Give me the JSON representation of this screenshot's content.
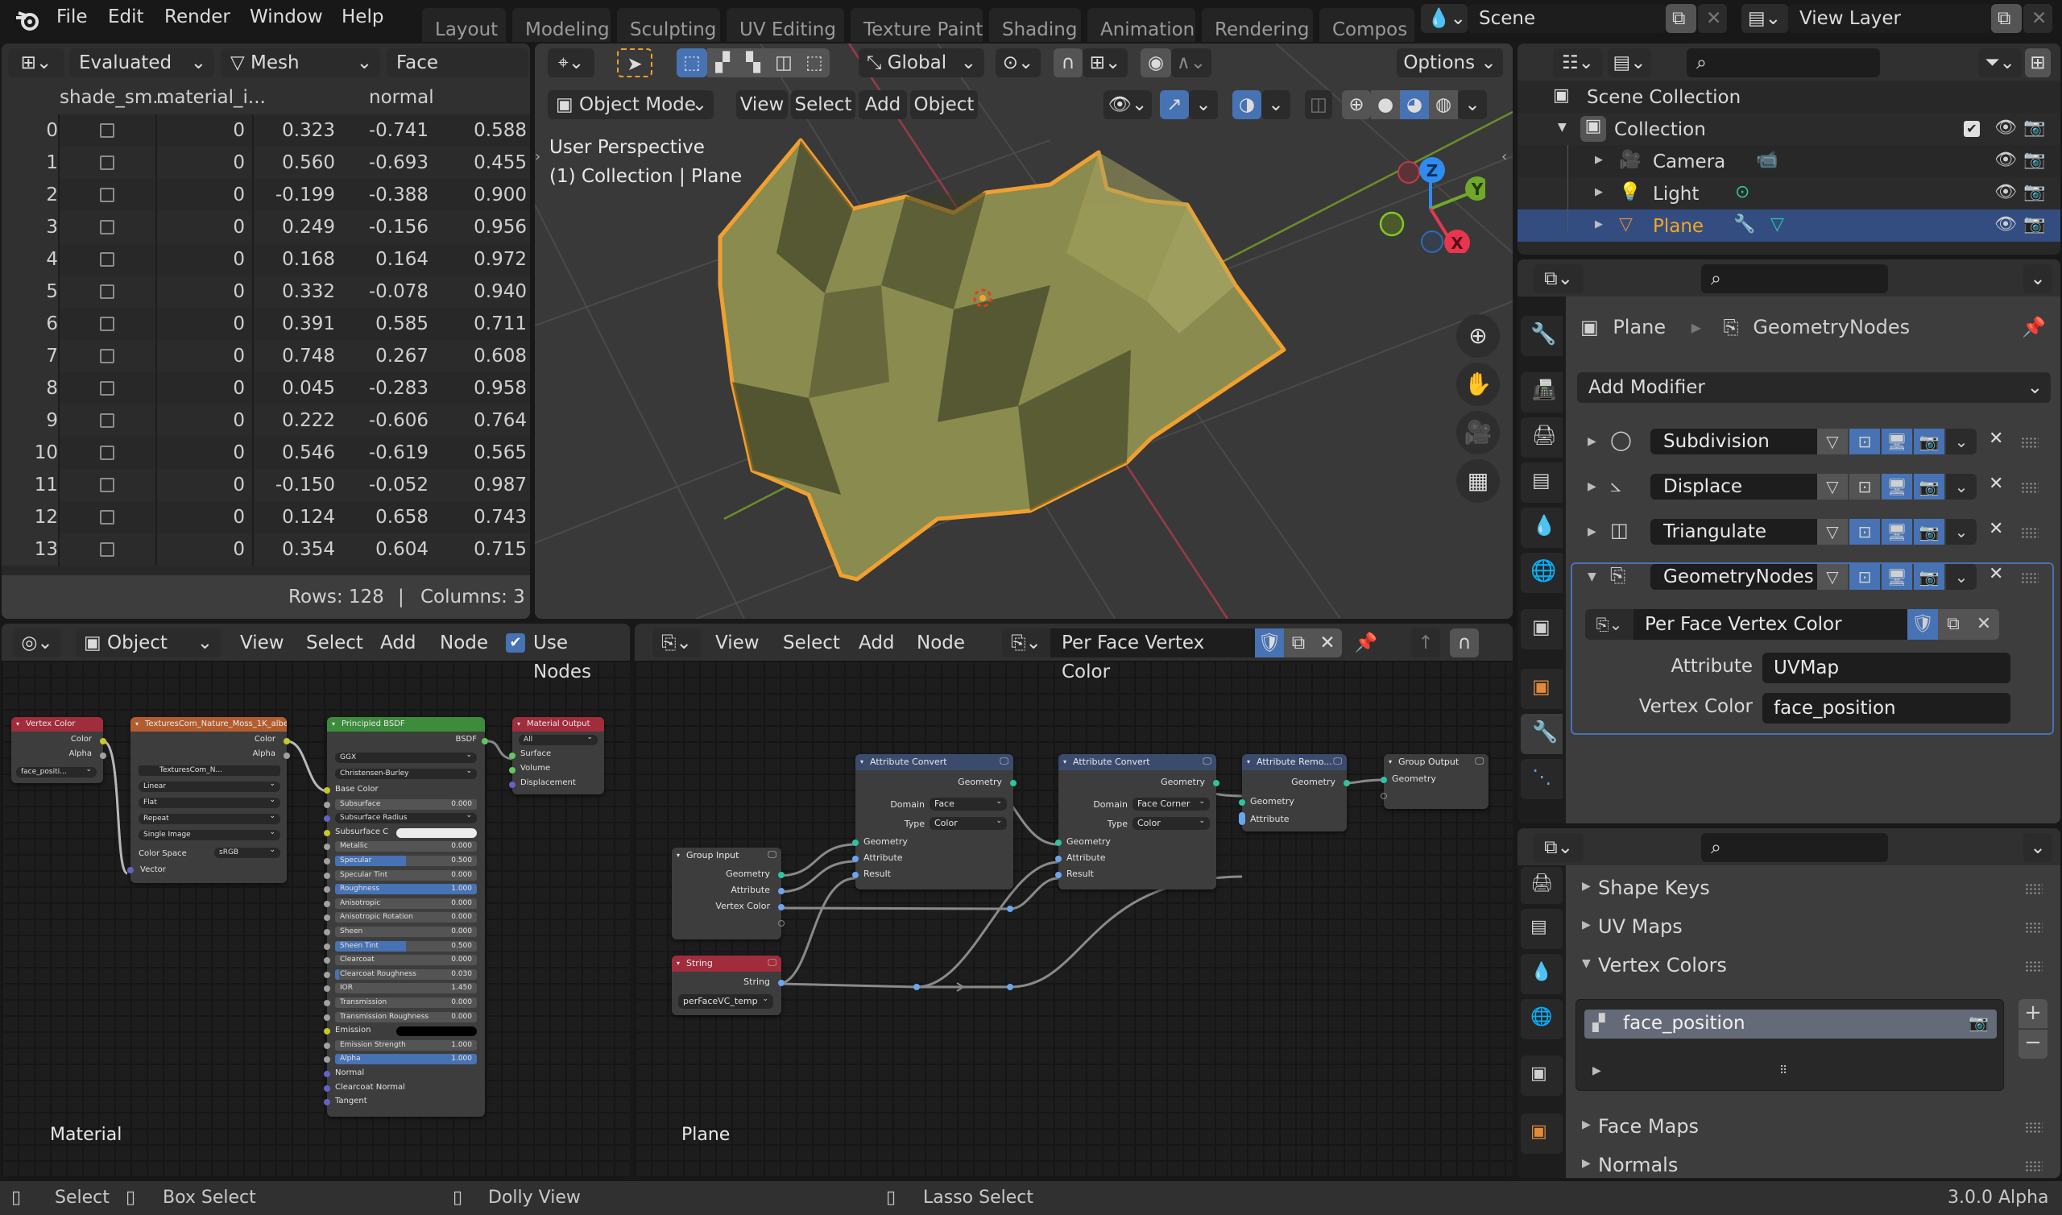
{
  "topbar": {
    "menu": [
      "File",
      "Edit",
      "Render",
      "Window",
      "Help"
    ],
    "workspaces": [
      "Layout",
      "Modeling",
      "Sculpting",
      "UV Editing",
      "Texture Paint",
      "Shading",
      "Animation",
      "Rendering",
      "Compos"
    ],
    "scene": "Scene",
    "view_layer": "View Layer"
  },
  "spreadsheet": {
    "evaluated": "Evaluated",
    "object_type": "Mesh",
    "domain": "Face",
    "columns": [
      "shade_sm...",
      "material_i...",
      "normal"
    ],
    "rows": [
      {
        "i": "0",
        "smooth": false,
        "mat": "0",
        "n": [
          "0.323",
          "-0.741",
          "0.588"
        ]
      },
      {
        "i": "1",
        "smooth": false,
        "mat": "0",
        "n": [
          "0.560",
          "-0.693",
          "0.455"
        ]
      },
      {
        "i": "2",
        "smooth": false,
        "mat": "0",
        "n": [
          "-0.199",
          "-0.388",
          "0.900"
        ]
      },
      {
        "i": "3",
        "smooth": false,
        "mat": "0",
        "n": [
          "0.249",
          "-0.156",
          "0.956"
        ]
      },
      {
        "i": "4",
        "smooth": false,
        "mat": "0",
        "n": [
          "0.168",
          "0.164",
          "0.972"
        ]
      },
      {
        "i": "5",
        "smooth": false,
        "mat": "0",
        "n": [
          "0.332",
          "-0.078",
          "0.940"
        ]
      },
      {
        "i": "6",
        "smooth": false,
        "mat": "0",
        "n": [
          "0.391",
          "0.585",
          "0.711"
        ]
      },
      {
        "i": "7",
        "smooth": false,
        "mat": "0",
        "n": [
          "0.748",
          "0.267",
          "0.608"
        ]
      },
      {
        "i": "8",
        "smooth": false,
        "mat": "0",
        "n": [
          "0.045",
          "-0.283",
          "0.958"
        ]
      },
      {
        "i": "9",
        "smooth": false,
        "mat": "0",
        "n": [
          "0.222",
          "-0.606",
          "0.764"
        ]
      },
      {
        "i": "10",
        "smooth": false,
        "mat": "0",
        "n": [
          "0.546",
          "-0.619",
          "0.565"
        ]
      },
      {
        "i": "11",
        "smooth": false,
        "mat": "0",
        "n": [
          "-0.150",
          "-0.052",
          "0.987"
        ]
      },
      {
        "i": "12",
        "smooth": false,
        "mat": "0",
        "n": [
          "0.124",
          "0.658",
          "0.743"
        ]
      },
      {
        "i": "13",
        "smooth": false,
        "mat": "0",
        "n": [
          "0.354",
          "0.604",
          "0.715"
        ]
      }
    ],
    "footer": {
      "rows": "Rows: 128",
      "sep": "|",
      "columns": "Columns: 3"
    }
  },
  "viewport": {
    "transform_orientation": "Global",
    "options": "Options",
    "mode": "Object Mode",
    "menus": [
      "View",
      "Select",
      "Add",
      "Object"
    ],
    "overlay_line1": "User Perspective",
    "overlay_line2": "(1) Collection | Plane",
    "gizmo_axes": [
      "Z",
      "Y",
      "X"
    ]
  },
  "outliner": {
    "root": "Scene Collection",
    "collection": "Collection",
    "items": [
      {
        "name": "Camera",
        "selected": false
      },
      {
        "name": "Light",
        "selected": false
      },
      {
        "name": "Plane",
        "selected": true
      }
    ]
  },
  "properties": {
    "breadcrumb": [
      "Plane",
      "GeometryNodes"
    ],
    "add_modifier": "Add Modifier",
    "modifiers": [
      {
        "name": "Subdivision",
        "editmode": true
      },
      {
        "name": "Displace",
        "editmode": false
      },
      {
        "name": "Triangulate",
        "editmode": true
      },
      {
        "name": "GeometryNodes",
        "editmode": true,
        "expanded": true
      }
    ],
    "node_group": "Per Face Vertex Color",
    "fields": [
      {
        "label": "Attribute",
        "value": "UVMap"
      },
      {
        "label": "Vertex Color",
        "value": "face_position"
      }
    ]
  },
  "data_panel": {
    "sections_before": [
      "Shape Keys",
      "UV Maps"
    ],
    "vertex_colors_title": "Vertex Colors",
    "vertex_color_items": [
      "face_position"
    ],
    "sections_after": [
      "Face Maps",
      "Normals"
    ]
  },
  "shader_editor": {
    "object": "Object",
    "menus": [
      "View",
      "Select",
      "Add",
      "Node"
    ],
    "use_nodes": "Use Nodes",
    "label": "Material",
    "vertex_color_node": {
      "title": "Vertex Color",
      "outputs": [
        "Color",
        "Alpha"
      ],
      "layer": "face_positi..."
    },
    "image_node": {
      "title": "TexturesCom_Nature_Moss_1K_albe...",
      "outputs": [
        "Color",
        "Alpha"
      ],
      "image": "TexturesCom_N...",
      "options": [
        "Linear",
        "Flat",
        "Repeat",
        "Single Image"
      ],
      "color_space_label": "Color Space",
      "color_space": "sRGB",
      "input": "Vector"
    },
    "bsdf_node": {
      "title": "Principled BSDF",
      "output": "BSDF",
      "distribution": "GGX",
      "subsurface_method": "Christensen-Burley",
      "inputs": [
        {
          "label": "Base Color",
          "kind": "socket"
        },
        {
          "label": "Subsurface",
          "value": "0.000",
          "fill": 0
        },
        {
          "label": "Subsurface Radius",
          "kind": "drop"
        },
        {
          "label": "Subsurface C",
          "kind": "color-white"
        },
        {
          "label": "Metallic",
          "value": "0.000",
          "fill": 0
        },
        {
          "label": "Specular",
          "value": "0.500",
          "fill": 0.5
        },
        {
          "label": "Specular Tint",
          "value": "0.000",
          "fill": 0
        },
        {
          "label": "Roughness",
          "value": "1.000",
          "fill": 1
        },
        {
          "label": "Anisotropic",
          "value": "0.000",
          "fill": 0
        },
        {
          "label": "Anisotropic Rotation",
          "value": "0.000",
          "fill": 0
        },
        {
          "label": "Sheen",
          "value": "0.000",
          "fill": 0
        },
        {
          "label": "Sheen Tint",
          "value": "0.500",
          "fill": 0.5
        },
        {
          "label": "Clearcoat",
          "value": "0.000",
          "fill": 0
        },
        {
          "label": "Clearcoat Roughness",
          "value": "0.030",
          "fill": 0.03
        },
        {
          "label": "IOR",
          "value": "1.450",
          "fill": 0
        },
        {
          "label": "Transmission",
          "value": "0.000",
          "fill": 0
        },
        {
          "label": "Transmission Roughness",
          "value": "0.000",
          "fill": 0
        },
        {
          "label": "Emission",
          "kind": "color-black"
        },
        {
          "label": "Emission Strength",
          "value": "1.000",
          "fill": 0
        },
        {
          "label": "Alpha",
          "value": "1.000",
          "fill": 1
        },
        {
          "label": "Normal",
          "kind": "socket"
        },
        {
          "label": "Clearcoat Normal",
          "kind": "socket"
        },
        {
          "label": "Tangent",
          "kind": "socket"
        }
      ]
    },
    "output_node": {
      "title": "Material Output",
      "target": "All",
      "inputs": [
        "Surface",
        "Volume",
        "Displacement"
      ]
    }
  },
  "geo_editor": {
    "menus": [
      "View",
      "Select",
      "Add",
      "Node"
    ],
    "node_group": "Per Face Vertex Color",
    "label": "Plane",
    "group_input": {
      "title": "Group Input",
      "outputs": [
        "Geometry",
        "Attribute",
        "Vertex Color"
      ]
    },
    "string_node": {
      "title": "String",
      "output": "String",
      "value": "perFaceVC_temp"
    },
    "convert1": {
      "title": "Attribute Convert",
      "output": "Geometry",
      "domain_label": "Domain",
      "domain": "Face",
      "type_label": "Type",
      "type": "Color",
      "inputs": [
        "Geometry",
        "Attribute",
        "Result"
      ]
    },
    "convert2": {
      "title": "Attribute Convert",
      "output": "Geometry",
      "domain_label": "Domain",
      "domain": "Face Corner",
      "type_label": "Type",
      "type": "Color",
      "inputs": [
        "Geometry",
        "Attribute",
        "Result"
      ]
    },
    "remove": {
      "title": "Attribute Remo...",
      "output": "Geometry",
      "inputs": [
        "Geometry",
        "Attribute"
      ]
    },
    "group_output": {
      "title": "Group Output",
      "inputs": [
        "Geometry"
      ]
    }
  },
  "statusbar": {
    "hints": [
      "Select",
      "Box Select",
      "Dolly View",
      "Lasso Select"
    ],
    "version": "3.0.0 Alpha"
  }
}
